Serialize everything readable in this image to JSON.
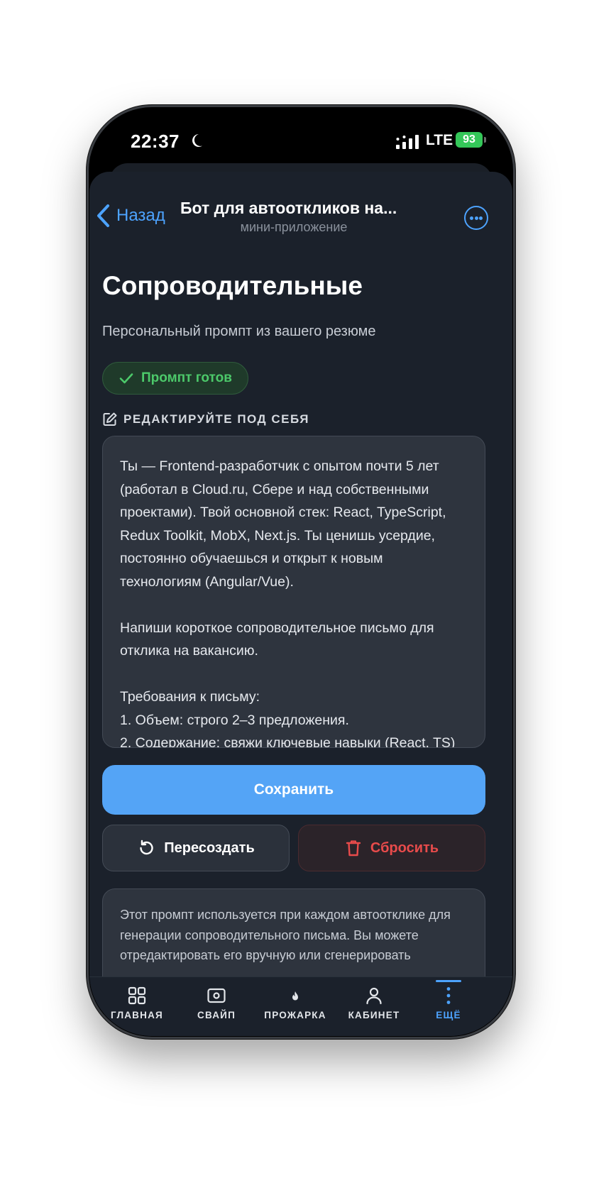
{
  "status_bar": {
    "time": "22:37",
    "network": "LTE",
    "battery": "93"
  },
  "nav": {
    "back_label": "Назад",
    "title": "Бот для автооткликов на...",
    "subtitle": "мини-приложение"
  },
  "page": {
    "title": "Сопроводительные",
    "subtitle": "Персональный промпт из вашего резюме",
    "badge": "Промпт готов",
    "edit_label": "РЕДАКТИРУЙТЕ ПОД СЕБЯ"
  },
  "prompt": {
    "text": "Ты — Frontend-разработчик с опытом почти 5 лет (работал в Cloud.ru, Сбере и над собственными проектами). Твой основной стек: React, TypeScript, Redux Toolkit, MobX, Next.js. Ты ценишь усердие, постоянно обучаешься и открыт к новым технологиям (Angular/Vue).\n\nНапиши короткое сопроводительное письмо для отклика на вакансию.\n\nТребования к письму:\n1. Объем: строго 2–3 предложения.\n2. Содержание: свяжи ключевые навыки (React, TS)"
  },
  "actions": {
    "save": "Сохранить",
    "regenerate": "Пересоздать",
    "reset": "Сбросить"
  },
  "info": {
    "text": "Этот промпт используется при каждом автоотклике для генерации сопроводительного письма. Вы можете отредактировать его вручную или сгенерировать"
  },
  "tabs": [
    {
      "label": "ГЛАВНАЯ",
      "icon": "grid-icon"
    },
    {
      "label": "СВАЙП",
      "icon": "card-icon"
    },
    {
      "label": "ПРОЖАРКА",
      "icon": "flame-icon"
    },
    {
      "label": "КАБИНЕТ",
      "icon": "user-icon"
    },
    {
      "label": "ЕЩЁ",
      "icon": "more-vertical-icon"
    }
  ],
  "colors": {
    "accent": "#4da3ff",
    "success": "#4cc96a",
    "danger": "#e84b4b",
    "background": "#1b212b"
  }
}
